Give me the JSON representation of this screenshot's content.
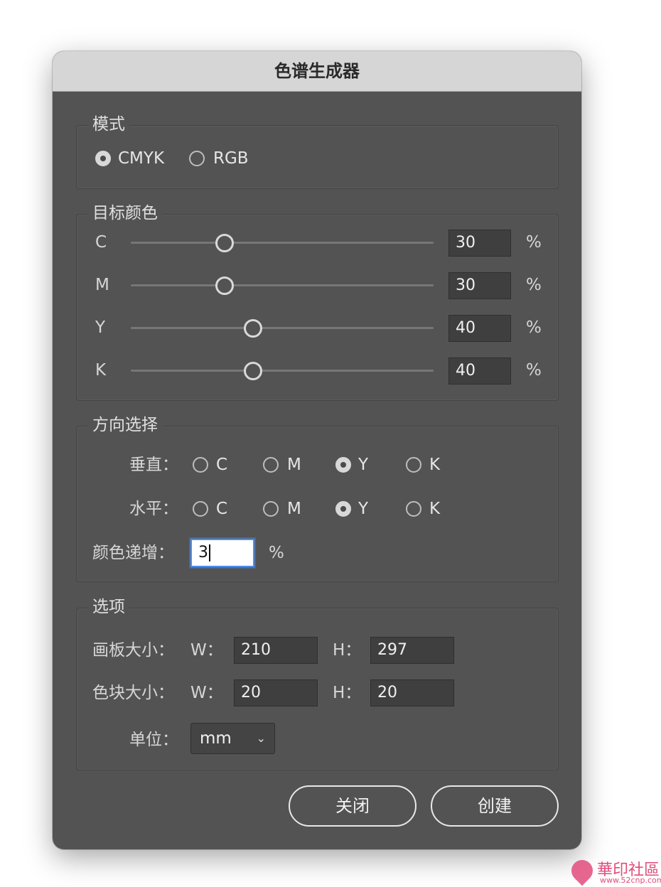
{
  "dialog": {
    "title": "色谱生成器"
  },
  "mode": {
    "legend": "模式",
    "options": [
      {
        "label": "CMYK",
        "selected": true
      },
      {
        "label": "RGB",
        "selected": false
      }
    ]
  },
  "target": {
    "legend": "目标颜色",
    "channels": [
      {
        "label": "C",
        "value": "30",
        "unit": "%"
      },
      {
        "label": "M",
        "value": "30",
        "unit": "%"
      },
      {
        "label": "Y",
        "value": "40",
        "unit": "%"
      },
      {
        "label": "K",
        "value": "40",
        "unit": "%"
      }
    ]
  },
  "direction": {
    "legend": "方向选择",
    "vertical": {
      "label": "垂直：",
      "options": [
        {
          "label": "C",
          "selected": false
        },
        {
          "label": "M",
          "selected": false
        },
        {
          "label": "Y",
          "selected": true
        },
        {
          "label": "K",
          "selected": false
        }
      ]
    },
    "horizontal": {
      "label": "水平：",
      "options": [
        {
          "label": "C",
          "selected": false
        },
        {
          "label": "M",
          "selected": false
        },
        {
          "label": "Y",
          "selected": true
        },
        {
          "label": "K",
          "selected": false
        }
      ]
    },
    "increment": {
      "label": "颜色递增：",
      "value": "3",
      "unit": "%"
    }
  },
  "options": {
    "legend": "选项",
    "artboard": {
      "label": "画板大小：",
      "w_label": "W：",
      "w_value": "210",
      "h_label": "H：",
      "h_value": "297"
    },
    "swatch": {
      "label": "色块大小：",
      "w_label": "W：",
      "w_value": "20",
      "h_label": "H：",
      "h_value": "20"
    },
    "unit": {
      "label": "单位：",
      "value": "mm"
    }
  },
  "buttons": {
    "close": "关闭",
    "create": "创建"
  },
  "watermark": {
    "text": "華印社區",
    "url": "www.52cnp.com"
  }
}
